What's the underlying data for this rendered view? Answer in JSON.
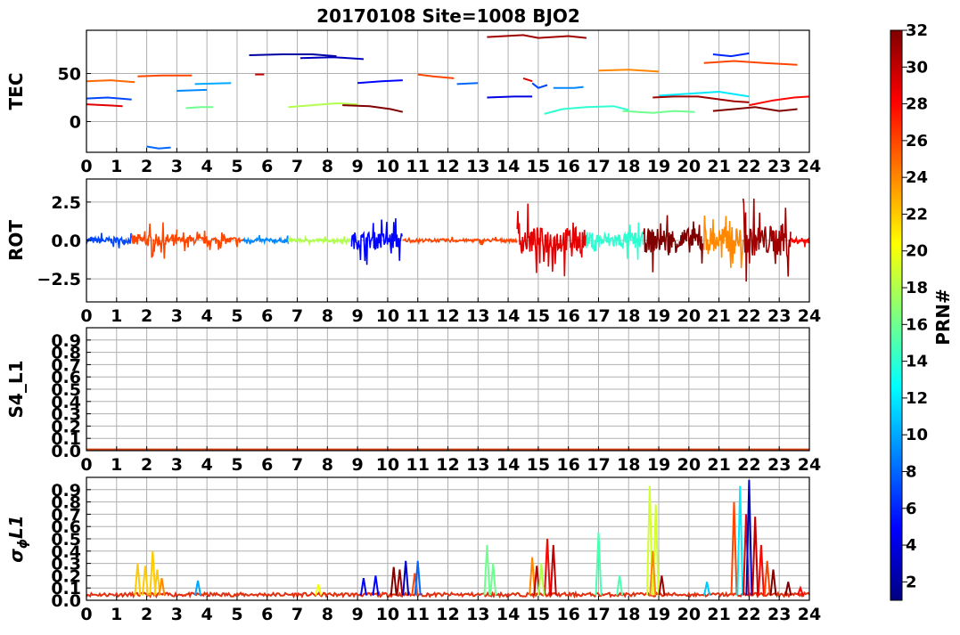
{
  "figure": {
    "title": "20170108 Site=1008 BJO2"
  },
  "colorbar": {
    "label": "PRN#",
    "range": [
      1,
      32
    ],
    "ticks": [
      2,
      4,
      6,
      8,
      10,
      12,
      14,
      16,
      18,
      20,
      22,
      24,
      26,
      28,
      30,
      32
    ],
    "colormap": "jet"
  },
  "chart_data": [
    {
      "type": "line",
      "panel": "tec",
      "title": "20170108 Site=1008 BJO2",
      "xlabel": "",
      "ylabel": "TEC",
      "xlim": [
        0,
        24
      ],
      "ylim": [
        -32,
        95
      ],
      "xticks": [
        0,
        1,
        2,
        3,
        4,
        5,
        6,
        7,
        8,
        9,
        10,
        11,
        12,
        13,
        14,
        15,
        16,
        17,
        18,
        19,
        20,
        21,
        22,
        23,
        24
      ],
      "yticks": [
        0,
        50
      ],
      "grid": true,
      "series": [
        {
          "prn": 2,
          "x": [
            5.4,
            6.5,
            7.5,
            8.3
          ],
          "y": [
            69,
            70,
            70,
            68
          ]
        },
        {
          "prn": 3,
          "x": [
            7.1,
            8.2,
            9.2,
            10.5
          ],
          "y": [
            66,
            67,
            65,
            61
          ]
        },
        {
          "prn": 4,
          "x": [
            13.3,
            14.2,
            14.8
          ],
          "y": [
            25,
            26,
            26
          ]
        },
        {
          "prn": 5,
          "x": [
            9.0,
            9.8,
            10.5
          ],
          "y": [
            40,
            42,
            43
          ]
        },
        {
          "prn": 6,
          "x": [
            20.8,
            21.4,
            22.0
          ],
          "y": [
            70,
            68,
            71
          ]
        },
        {
          "prn": 7,
          "x": [
            0.0,
            0.7,
            1.5,
            14.8,
            15.0,
            15.3
          ],
          "y": [
            24,
            25,
            23,
            40,
            35,
            38
          ]
        },
        {
          "prn": 8,
          "x": [
            2.0,
            2.4,
            2.8,
            12.3,
            13.0,
            14.5
          ],
          "y": [
            -26,
            -28,
            -27,
            39,
            40,
            41
          ]
        },
        {
          "prn": 9,
          "x": [
            3.0,
            4.0,
            5.2,
            15.5,
            16.2,
            16.5
          ],
          "y": [
            32,
            33,
            33,
            35,
            35,
            36
          ]
        },
        {
          "prn": 10,
          "x": [
            3.6,
            4.8,
            6.6,
            10.2,
            11.5,
            13.2
          ],
          "y": [
            39,
            40,
            41,
            32,
            35,
            37
          ]
        },
        {
          "prn": 12,
          "x": [
            19.0,
            20.0,
            21.0,
            22.0
          ],
          "y": [
            27,
            29,
            31,
            26
          ]
        },
        {
          "prn": 14,
          "x": [
            15.2,
            15.8,
            16.6,
            17.5,
            18.0
          ],
          "y": [
            8,
            13,
            15,
            16,
            12
          ]
        },
        {
          "prn": 16,
          "x": [
            3.3,
            3.8,
            4.2,
            17.8,
            18.8,
            19.5,
            20.2
          ],
          "y": [
            14,
            15,
            15,
            11,
            9,
            11,
            10
          ]
        },
        {
          "prn": 18,
          "x": [
            6.7,
            7.5,
            8.3,
            9.0
          ],
          "y": [
            15,
            17,
            19,
            18
          ]
        },
        {
          "prn": 24,
          "x": [
            17.0,
            18.0,
            19.0,
            20.5
          ],
          "y": [
            53,
            54,
            52,
            51
          ]
        },
        {
          "prn": 25,
          "x": [
            0.0,
            0.8,
            1.6
          ],
          "y": [
            42,
            43,
            41
          ]
        },
        {
          "prn": 26,
          "x": [
            1.7,
            2.5,
            3.5,
            5.0,
            11.0,
            11.5,
            12.2,
            20.5,
            21.5,
            22.5,
            23.6
          ],
          "y": [
            47,
            48,
            48,
            46,
            49,
            47,
            45,
            61,
            63,
            61,
            59
          ]
        },
        {
          "prn": 28,
          "x": [
            22.0,
            22.8,
            23.5,
            24.0
          ],
          "y": [
            17,
            22,
            25,
            26
          ]
        },
        {
          "prn": 29,
          "x": [
            0.0,
            0.6,
            1.2,
            14.5,
            14.8
          ],
          "y": [
            18,
            17,
            16,
            45,
            42
          ]
        },
        {
          "prn": 30,
          "x": [
            5.6,
            5.9
          ],
          "y": [
            49,
            49
          ]
        },
        {
          "prn": 31,
          "x": [
            13.3,
            14.5,
            15.0,
            16.0,
            16.6,
            18.8,
            19.5,
            20.3,
            21.5,
            22.0
          ],
          "y": [
            88,
            90,
            87,
            89,
            87,
            25,
            26,
            26,
            21,
            20
          ]
        },
        {
          "prn": 32,
          "x": [
            8.5,
            9.4,
            10.1,
            10.5,
            20.8,
            21.5,
            22.2,
            23.0,
            23.6
          ],
          "y": [
            17,
            16,
            13,
            10,
            11,
            13,
            15,
            11,
            13
          ]
        }
      ]
    },
    {
      "type": "line",
      "panel": "rot",
      "xlabel": "",
      "ylabel": "ROT",
      "xlim": [
        0,
        24
      ],
      "ylim": [
        -4.0,
        4.0
      ],
      "xticks": [
        0,
        1,
        2,
        3,
        4,
        5,
        6,
        7,
        8,
        9,
        10,
        11,
        12,
        13,
        14,
        15,
        16,
        17,
        18,
        19,
        20,
        21,
        22,
        23,
        24
      ],
      "yticks": [
        -2.5,
        0.0,
        2.5
      ],
      "ytick_labels": [
        "−2.5",
        "0.0",
        "2.5"
      ],
      "grid": true,
      "activity": [
        {
          "t0": 0.0,
          "t1": 1.5,
          "amp": 0.6,
          "prn": 7
        },
        {
          "t0": 1.5,
          "t1": 3.0,
          "amp": 1.2,
          "prn": 26
        },
        {
          "t0": 3.0,
          "t1": 5.2,
          "amp": 0.7,
          "prn": 26
        },
        {
          "t0": 5.2,
          "t1": 6.7,
          "amp": 0.35,
          "prn": 9
        },
        {
          "t0": 6.7,
          "t1": 8.8,
          "amp": 0.3,
          "prn": 18
        },
        {
          "t0": 8.8,
          "t1": 10.5,
          "amp": 1.6,
          "prn": 5
        },
        {
          "t0": 10.5,
          "t1": 14.3,
          "amp": 0.3,
          "prn": 26
        },
        {
          "t0": 14.3,
          "t1": 16.6,
          "amp": 2.5,
          "prn": 29
        },
        {
          "t0": 16.6,
          "t1": 18.5,
          "amp": 1.6,
          "prn": 14
        },
        {
          "t0": 18.5,
          "t1": 20.5,
          "amp": 2.3,
          "prn": 32
        },
        {
          "t0": 20.5,
          "t1": 21.8,
          "amp": 2.6,
          "prn": 24
        },
        {
          "t0": 21.8,
          "t1": 23.4,
          "amp": 2.9,
          "prn": 31
        },
        {
          "t0": 23.4,
          "t1": 24.0,
          "amp": 0.5,
          "prn": 28
        }
      ]
    },
    {
      "type": "line",
      "panel": "s4",
      "xlabel": "",
      "ylabel": "S4_L1",
      "xlim": [
        0,
        24
      ],
      "ylim": [
        0.0,
        1.0
      ],
      "xticks": [
        0,
        1,
        2,
        3,
        4,
        5,
        6,
        7,
        8,
        9,
        10,
        11,
        12,
        13,
        14,
        15,
        16,
        17,
        18,
        19,
        20,
        21,
        22,
        23,
        24
      ],
      "yticks": [
        0.0,
        0.1,
        0.2,
        0.3,
        0.4,
        0.5,
        0.6,
        0.7,
        0.8,
        0.9
      ],
      "ytick_labels": [
        "0.0",
        "0.1",
        "0.2",
        "0.3",
        "0.4",
        "0.5",
        "0.6",
        "0.7",
        "0.8",
        "0.9"
      ],
      "grid": true,
      "baseline": 0.01
    },
    {
      "type": "line",
      "panel": "sigma",
      "xlabel": "",
      "ylabel_main": "σ",
      "ylabel_sub": "ϕ",
      "ylabel_tail": "L1",
      "xlim": [
        0,
        24
      ],
      "ylim": [
        0.0,
        1.0
      ],
      "xticks": [
        0,
        1,
        2,
        3,
        4,
        5,
        6,
        7,
        8,
        9,
        10,
        11,
        12,
        13,
        14,
        15,
        16,
        17,
        18,
        19,
        20,
        21,
        22,
        23,
        24
      ],
      "yticks": [
        0.0,
        0.1,
        0.2,
        0.3,
        0.4,
        0.5,
        0.6,
        0.7,
        0.8,
        0.9
      ],
      "ytick_labels": [
        "0.0",
        "0.1",
        "0.2",
        "0.3",
        "0.4",
        "0.5",
        "0.6",
        "0.7",
        "0.8",
        "0.9"
      ],
      "grid": true,
      "baseline": 0.04,
      "spikes": [
        {
          "x": 1.7,
          "y": 0.3,
          "prn": 22
        },
        {
          "x": 1.95,
          "y": 0.28,
          "prn": 22
        },
        {
          "x": 2.2,
          "y": 0.4,
          "prn": 22
        },
        {
          "x": 2.35,
          "y": 0.25,
          "prn": 22
        },
        {
          "x": 2.5,
          "y": 0.18,
          "prn": 24
        },
        {
          "x": 3.7,
          "y": 0.16,
          "prn": 10
        },
        {
          "x": 7.7,
          "y": 0.13,
          "prn": 20
        },
        {
          "x": 9.2,
          "y": 0.18,
          "prn": 5
        },
        {
          "x": 9.6,
          "y": 0.2,
          "prn": 5
        },
        {
          "x": 10.2,
          "y": 0.27,
          "prn": 32
        },
        {
          "x": 10.4,
          "y": 0.25,
          "prn": 31
        },
        {
          "x": 10.6,
          "y": 0.32,
          "prn": 3
        },
        {
          "x": 10.9,
          "y": 0.22,
          "prn": 26
        },
        {
          "x": 11.0,
          "y": 0.32,
          "prn": 8
        },
        {
          "x": 13.3,
          "y": 0.45,
          "prn": 16
        },
        {
          "x": 13.5,
          "y": 0.3,
          "prn": 16
        },
        {
          "x": 14.8,
          "y": 0.35,
          "prn": 24
        },
        {
          "x": 14.95,
          "y": 0.28,
          "prn": 30
        },
        {
          "x": 15.3,
          "y": 0.5,
          "prn": 28
        },
        {
          "x": 15.5,
          "y": 0.45,
          "prn": 30
        },
        {
          "x": 15.1,
          "y": 0.3,
          "prn": 18
        },
        {
          "x": 17.0,
          "y": 0.55,
          "prn": 15
        },
        {
          "x": 17.7,
          "y": 0.2,
          "prn": 15
        },
        {
          "x": 18.7,
          "y": 0.93,
          "prn": 19
        },
        {
          "x": 18.9,
          "y": 0.78,
          "prn": 19
        },
        {
          "x": 18.8,
          "y": 0.4,
          "prn": 24
        },
        {
          "x": 19.1,
          "y": 0.2,
          "prn": 31
        },
        {
          "x": 20.6,
          "y": 0.15,
          "prn": 11
        },
        {
          "x": 21.5,
          "y": 0.8,
          "prn": 26
        },
        {
          "x": 21.7,
          "y": 0.93,
          "prn": 12
        },
        {
          "x": 21.9,
          "y": 0.7,
          "prn": 29
        },
        {
          "x": 22.0,
          "y": 0.98,
          "prn": 3
        },
        {
          "x": 22.2,
          "y": 0.68,
          "prn": 30
        },
        {
          "x": 22.4,
          "y": 0.45,
          "prn": 28
        },
        {
          "x": 22.6,
          "y": 0.32,
          "prn": 26
        },
        {
          "x": 22.8,
          "y": 0.25,
          "prn": 32
        },
        {
          "x": 23.3,
          "y": 0.15,
          "prn": 32
        },
        {
          "x": 23.7,
          "y": 0.1,
          "prn": 28
        }
      ]
    }
  ]
}
